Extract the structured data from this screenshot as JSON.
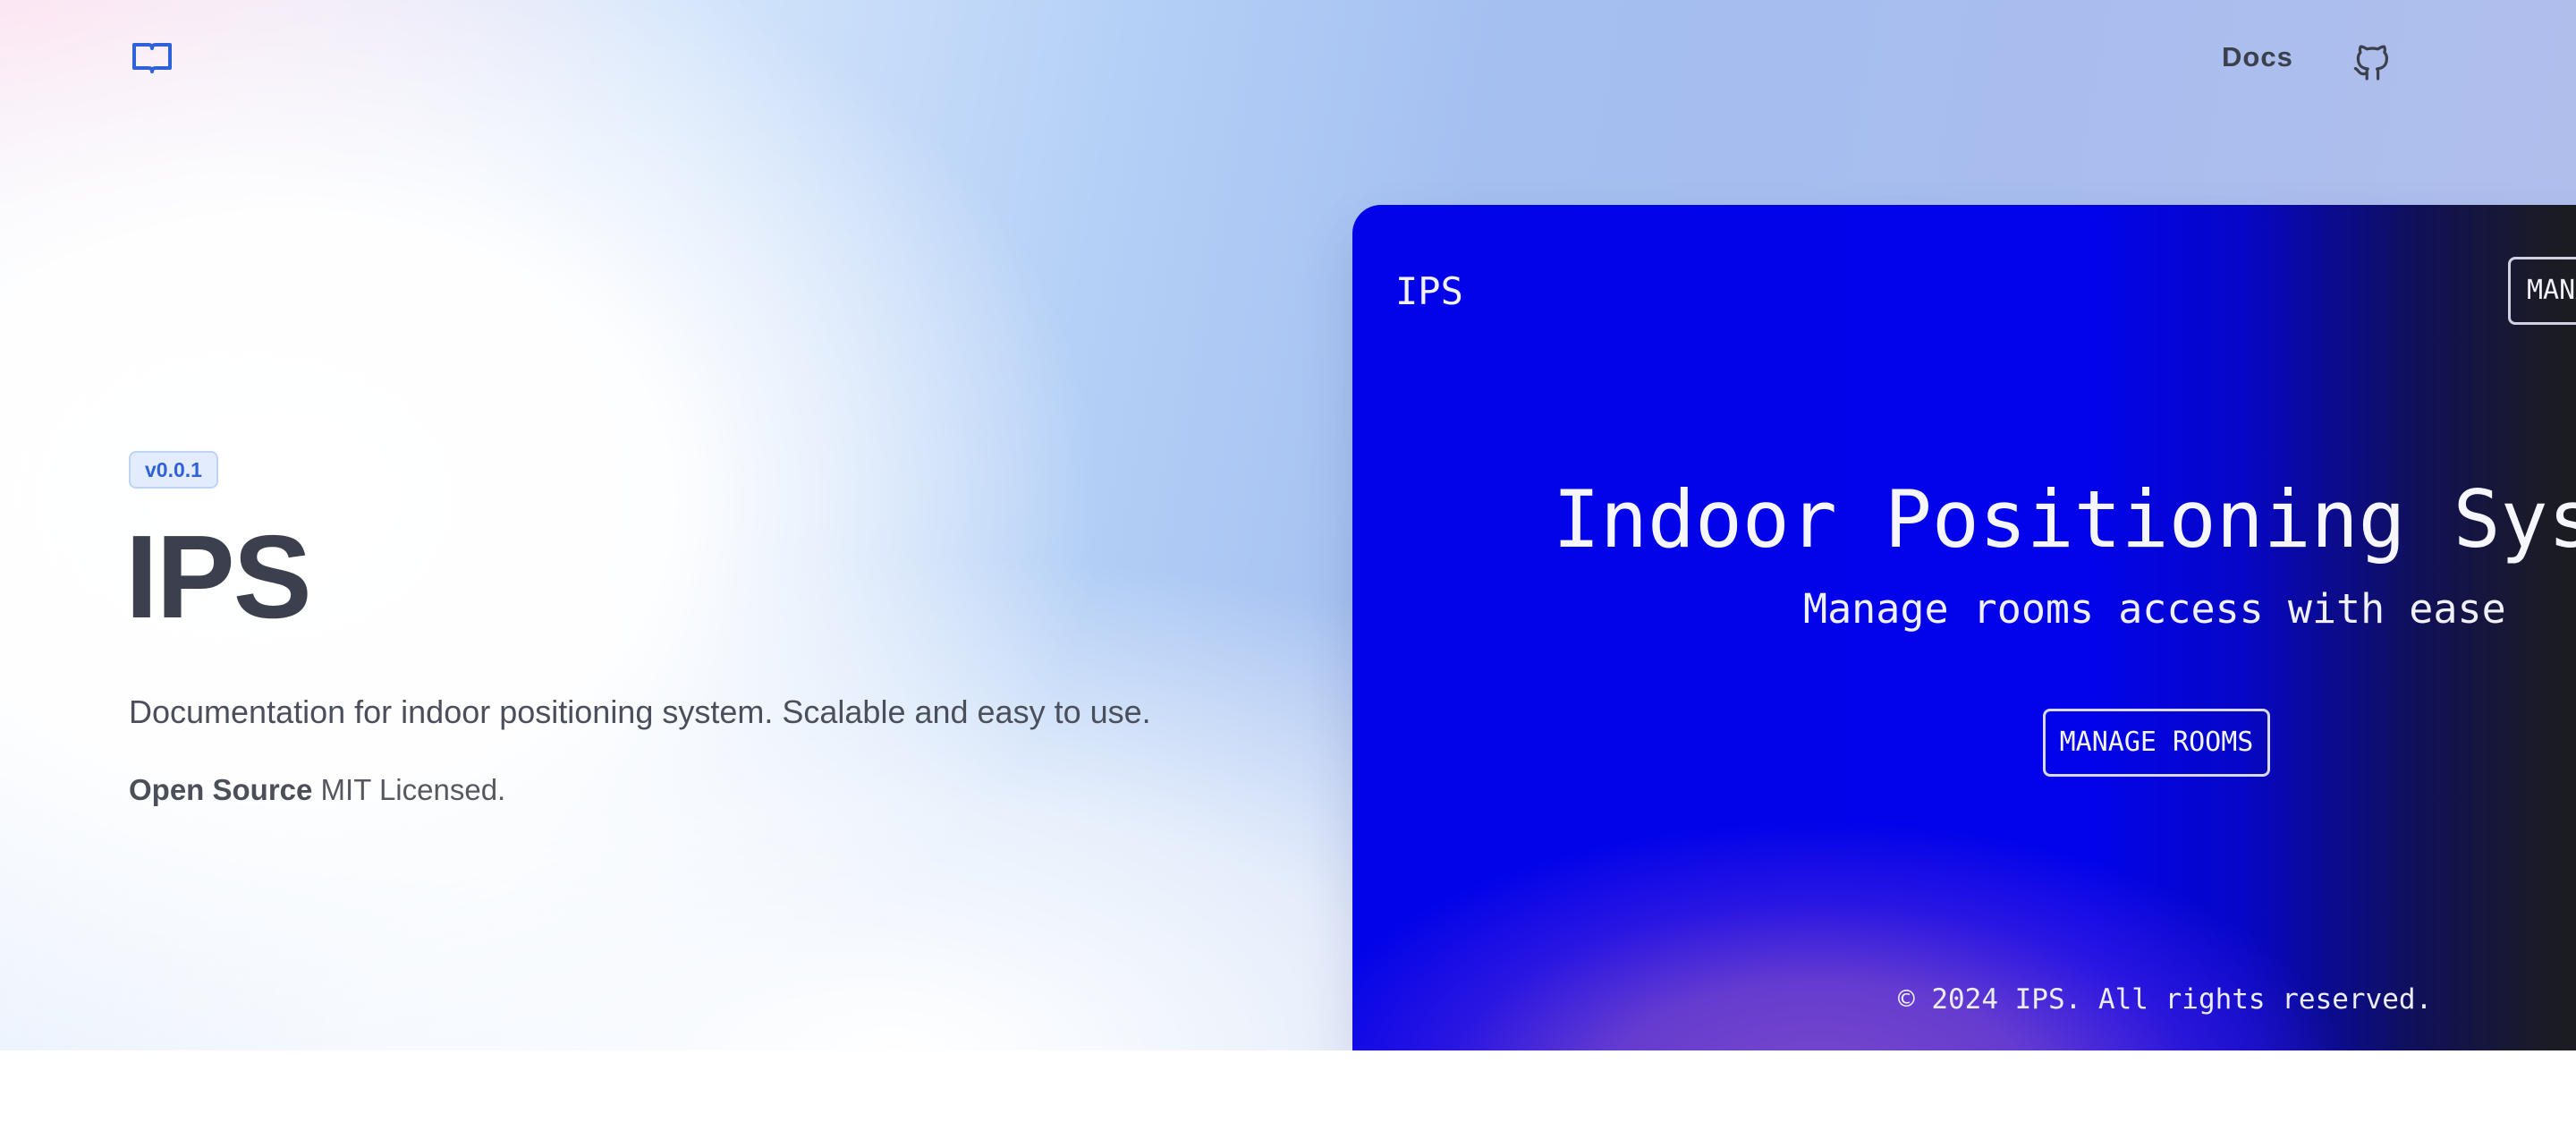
{
  "header": {
    "logo_icon": "book-open-icon",
    "nav": {
      "docs_label": "Docs",
      "github_icon": "github-icon"
    }
  },
  "hero": {
    "version_badge": "v0.0.1",
    "title": "IPS",
    "description": "Documentation for indoor positioning system. Scalable and easy to use.",
    "license_bold": "Open Source",
    "license_text": " MIT Licensed."
  },
  "preview": {
    "brand": "IPS",
    "nav_button": "MANAGE ROOMS",
    "title": "Indoor Positioning System",
    "subtitle": "Manage rooms access with ease",
    "cta_button": "MANAGE ROOMS",
    "footer": "© 2024 IPS. All rights reserved."
  },
  "colors": {
    "accent": "#2f62d8",
    "title_text": "#3b3f4e",
    "preview_blue": "#0203e8",
    "preview_purple": "#7a4ac8"
  }
}
